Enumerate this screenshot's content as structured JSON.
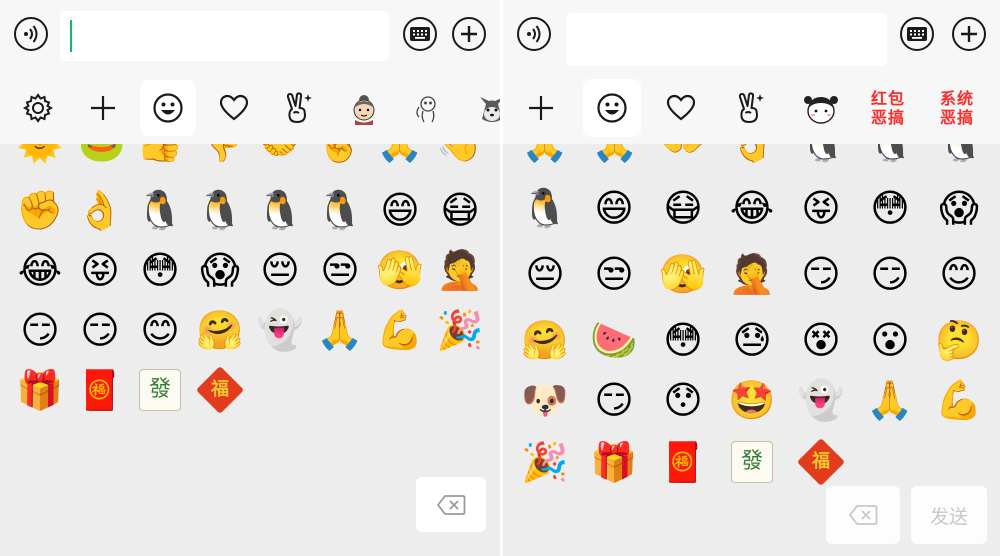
{
  "left": {
    "tabs": [
      "gear-icon",
      "plus-icon",
      "smiley-icon",
      "heart-icon",
      "victory-hand-icon",
      "sticker-grandma",
      "sticker-line",
      "sticker-dog"
    ],
    "partial_row": [
      "🌞",
      "🐸",
      "👍",
      "👎",
      "🤝",
      "✌️",
      "🙏",
      "👋"
    ],
    "rows": [
      [
        "✊",
        "👌",
        "🐧",
        "🐧",
        "🐧",
        "🐧",
        "😄",
        "😷"
      ],
      [
        "😂",
        "😝",
        "😳",
        "😱",
        "😔",
        "😒",
        "🫣",
        "🤦"
      ],
      [
        "😏",
        "😏",
        "😊",
        "🤗",
        "👻",
        "🙏",
        "💪",
        "🎉"
      ],
      [
        "🎁",
        "🧧",
        "發",
        "福"
      ]
    ]
  },
  "right": {
    "tabs": [
      "plus-icon",
      "smiley-icon",
      "heart-icon",
      "victory-hand-icon",
      "sticker-girl"
    ],
    "text_tabs": [
      "红包\n恶搞",
      "系统\n恶搞"
    ],
    "partial_row": [
      "🙏",
      "🙏",
      "👐",
      "👌",
      "🐧",
      "🐧",
      "🐧"
    ],
    "rows": [
      [
        "🐧",
        "😄",
        "😷",
        "😂",
        "😝",
        "😳",
        "😱"
      ],
      [
        "😔",
        "😒",
        "🫣",
        "🤦",
        "😏",
        "😏",
        "😊"
      ],
      [
        "🤗",
        "🍉",
        "😳",
        "😓",
        "😵",
        "😮",
        "🤔"
      ],
      [
        "🐶",
        "😏",
        "😯",
        "🤩",
        "👻",
        "🙏",
        "💪"
      ],
      [
        "🎉",
        "🎁",
        "🧧",
        "發",
        "福"
      ]
    ],
    "send_label": "发送"
  },
  "colors": {
    "cursor": "#07c160",
    "red_text": "#fa2c2c",
    "panel_bg": "#ededed",
    "bar_bg": "#f7f7f7"
  }
}
